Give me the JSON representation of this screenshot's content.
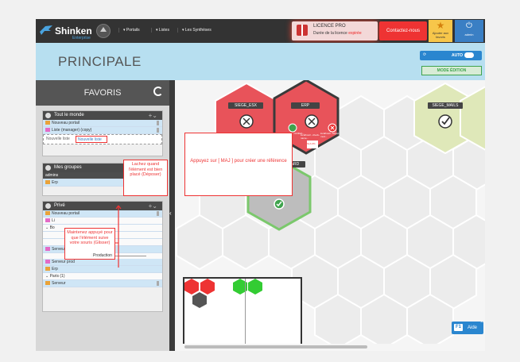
{
  "topbar": {
    "logo": "Shinken",
    "logo_sub": "Enterprise",
    "nav": [
      "Portails",
      "Listes",
      "Les Synthèses"
    ],
    "licence_title": "LICENCE PRO",
    "licence_text": "Durée de la licence ",
    "licence_status": "expirée",
    "contact": "Contactez-nous",
    "favorites": "Ajouter aux favoris",
    "admin": "admin"
  },
  "header": {
    "title": "PRINCIPALE",
    "auto": "AUTO",
    "mode": "MODE ÉDITION"
  },
  "sidebar": {
    "title": "FAVORIS",
    "panels": {
      "everyone": {
        "title": "Tout le monde",
        "items": [
          "Nouveau portail",
          "Liste (manager) (copy)"
        ],
        "drop_label": "Nouvelle liste",
        "drop_chip": "Nouvelle liste"
      },
      "groups": {
        "title": "Mes groupes",
        "group": "admins",
        "items": [
          "Erp"
        ]
      },
      "private": {
        "title": "Privé",
        "items": [
          "Nouveau portail",
          "Li",
          "Bo",
          "Serveur Compta",
          "Production",
          "Serveur prod",
          "Erp",
          "Paris (1)",
          "Serveur"
        ]
      }
    },
    "tips": {
      "drop": "Lachez quand l'élément est bien placé (Déposer)",
      "drag": "Maintenez appuyé pour que l'élément suive votre souris (Glisser)"
    }
  },
  "canvas": {
    "hex_labels": [
      "SIEGE_ESX",
      "ERP",
      "SIEGE_MAILS",
      "ARD"
    ],
    "erp_subs": [
      "localhost/...\\Artifact...",
      "localhost/...Mysql-mod...",
      "localhost/...check-name...",
      "SLA 0%"
    ],
    "tip": "Appuyez sur [ MAJ ] pour créer une référence",
    "help": "Aide",
    "help_key": "F1"
  },
  "colors": {
    "red": "#e8535a",
    "green": "#3fa34d",
    "pale": "#dfe8b9",
    "blue": "#2a86cf"
  }
}
